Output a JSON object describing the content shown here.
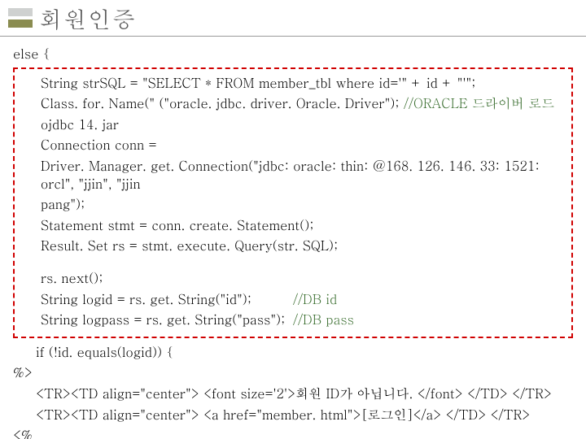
{
  "title": "회원인증",
  "code": {
    "l1": "else {",
    "l2": "String strSQL = \"SELECT * FROM member_tbl  where id='\" + id + \"'\";",
    "l3a": "Class. for. Name(\" (\"oracle. jdbc. driver. Oracle. Driver\");   ",
    "l3b": "//ORACLE 드라이버 로드",
    "l3c": "ojdbc 14. jar",
    "l4a": "Connection conn =",
    "l4b": "Driver. Manager. get. Connection(\"jdbc: oracle: thin: @168. 126. 146. 33: 1521: orcl\", \"jjin\", \"jjin",
    "l4c": "pang\");",
    "l5": "Statement stmt = conn. create. Statement();",
    "l6": "Result. Set rs = stmt. execute. Query(str. SQL);",
    "l7": "rs. next();",
    "l8a": "String logid = rs. get. String(\"id\");",
    "l8b": "//DB id",
    "l9a": "String logpass = rs. get. String(\"pass\");",
    "l9b": "//DB pass",
    "l10": "if (!id. equals(logid)) {",
    "l11": "%>",
    "l12": "<TR><TD align=\"center\"> <font size='2'>회원 ID가 아닙니다. </font> </TD> </TR>",
    "l13": "<TR><TD align=\"center\"> <a href=\"member. html\">[로그인]</a> </TD> </TR>",
    "l14": "<%"
  }
}
